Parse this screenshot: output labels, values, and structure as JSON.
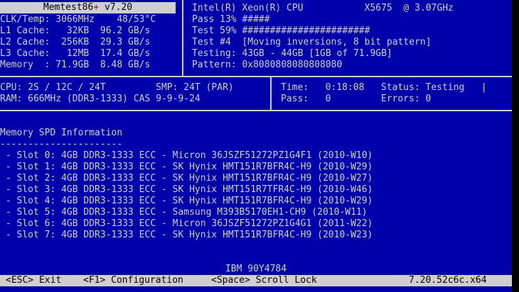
{
  "colors": {
    "background": "#0000aa",
    "text": "#cfcfcf",
    "bar": "#cfcfcf",
    "bar_text": "#000000",
    "accent": "#aa0000"
  },
  "title": {
    "name": "Memtest86",
    "plus": "+",
    "version": " v7.20"
  },
  "left_stats": [
    "CLK/Temp: 3066MHz    48/53°C",
    "L1 Cache:   32KB  96.2 GB/s",
    "L2 Cache:  256KB  29.3 GB/s",
    "L3 Cache:   12MB  17.4 GB/s",
    "Memory  : 71.9GB  8.48 GB/s"
  ],
  "cpu_panel": [
    "Intel(R) Xeon(R) CPU           X5675  @ 3.07GHz",
    "Pass 13% #####",
    "Test 59% #######################",
    "Test #4  [Moving inversions, 8 bit pattern]",
    "Testing: 43GB - 44GB [1GB of 71.9GB]",
    "Pattern: 0x8080808080808080"
  ],
  "cpu_info": [
    "CPU: 2S / 12C / 24T         SMP: 24T (PAR)",
    "RAM: 666MHz (DDR3-1333) CAS 9-9-9-24"
  ],
  "time_info": [
    "Time:   0:18:08   Status: Testing   |",
    "Pass:   0         Errors: 0"
  ],
  "spd": {
    "title": "Memory SPD Information",
    "underline": "----------------------",
    "slots": [
      " - Slot 0: 4GB DDR3-1333 ECC - Micron 36JSZF51272PZ1G4F1 (2010-W10)",
      " - Slot 1: 4GB DDR3-1333 ECC - SK Hynix HMT151R7BFR4C-H9 (2010-W29)",
      " - Slot 2: 4GB DDR3-1333 ECC - SK Hynix HMT151R7BFR4C-H9 (2010-W27)",
      " - Slot 3: 4GB DDR3-1333 ECC - SK Hynix HMT151R7TFR4C-H9 (2010-W46)",
      " - Slot 4: 4GB DDR3-1333 ECC - SK Hynix HMT151R7BFR4C-H9 (2010-W29)",
      " - Slot 5: 4GB DDR3-1333 ECC - Samsung M393B5170EH1-CH9 (2010-W11)",
      " - Slot 6: 4GB DDR3-1333 ECC - Micron 36JSZF51272PZ1G4G1 (2011-W22)",
      " - Slot 7: 4GB DDR3-1333 ECC - SK Hynix HMT151R7BFR4C-H9 (2010-W23)"
    ]
  },
  "footer": {
    "model": "IBM 90Y4784",
    "esc_label": "<ESC> Exit",
    "f1_label": "<F1> Configuration",
    "space_label": "<Space> Scroll Lock",
    "version": "7.20.52c6c.x64"
  }
}
